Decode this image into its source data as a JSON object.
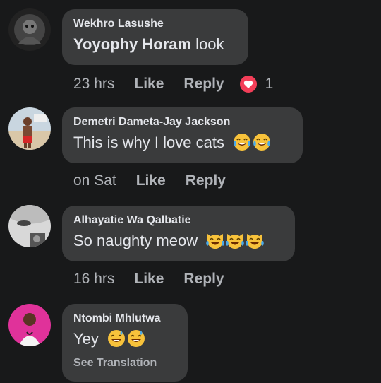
{
  "comments": [
    {
      "author": "Wekhro Lasushe",
      "mention": "Yoyophy Horam",
      "text": " look",
      "time": "23 hrs",
      "like": "Like",
      "reply": "Reply",
      "reaction_count": "1"
    },
    {
      "author": "Demetri Dameta-Jay Jackson",
      "text": "This is why I love cats",
      "time": "on Sat",
      "like": "Like",
      "reply": "Reply"
    },
    {
      "author": "Alhayatie Wa Qalbatie",
      "text": "So naughty meow",
      "time": "16 hrs",
      "like": "Like",
      "reply": "Reply"
    },
    {
      "author": "Ntombi Mhlutwa",
      "text": "Yey",
      "see_translation": "See Translation"
    }
  ],
  "colors": {
    "background": "#18191a",
    "bubble": "#3a3b3c",
    "secondary_text": "#b0b3b8",
    "heart": "#f33e58"
  }
}
